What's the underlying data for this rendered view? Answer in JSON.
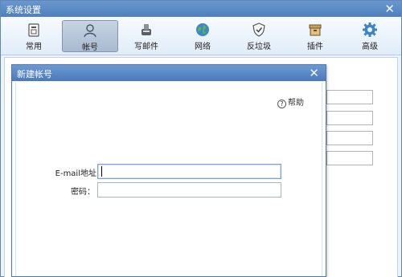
{
  "window": {
    "title": "系统设置",
    "close_glyph": "✕"
  },
  "toolbar": {
    "items": [
      {
        "label": "常用",
        "icon": "calendar-icon"
      },
      {
        "label": "帐号",
        "icon": "user-icon",
        "active": true
      },
      {
        "label": "写邮件",
        "icon": "write-mail-icon"
      },
      {
        "label": "网络",
        "icon": "globe-icon"
      },
      {
        "label": "反垃圾",
        "icon": "shield-icon"
      },
      {
        "label": "插件",
        "icon": "box-icon"
      },
      {
        "label": "高级",
        "icon": "gear-icon"
      }
    ]
  },
  "dialog": {
    "title": "新建帐号",
    "close_glyph": "✕",
    "help_label": "帮助",
    "email_label": "E-mail地址：",
    "email_value": "",
    "password_label": "密码：",
    "password_value": ""
  },
  "colors": {
    "title_bar": "#5686c4",
    "toolbar_bg": "#eaf2fb",
    "active_tab": "#b7c7da"
  }
}
